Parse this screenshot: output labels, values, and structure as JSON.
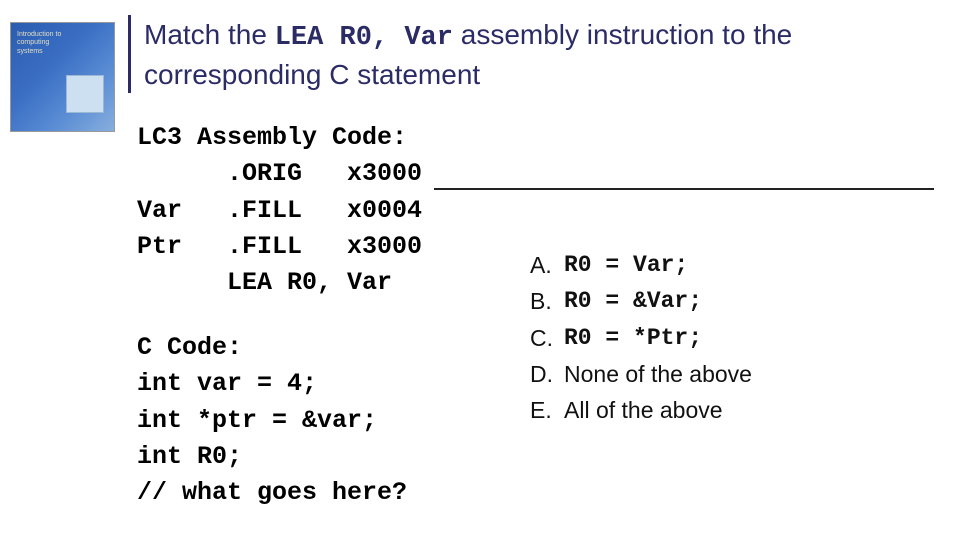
{
  "book": {
    "title_line1": "Introduction to",
    "title_line2": "computing systems"
  },
  "title": {
    "pre": "Match the ",
    "code": "LEA R0, Var",
    "post": " assembly instruction to the corresponding C statement"
  },
  "asm": {
    "header": "LC3 Assembly Code:",
    "l1": "      .ORIG   x3000",
    "l2": "Var   .FILL   x0004",
    "l3": "Ptr   .FILL   x3000",
    "l4": "      LEA R0, Var"
  },
  "ccode": {
    "header": "C Code:",
    "l1": "int var = 4;",
    "l2": "int *ptr = &var;",
    "l3": "int R0;",
    "l4": "// what goes here?"
  },
  "answers": {
    "a": {
      "label": "A.",
      "text": "R0 = Var;"
    },
    "b": {
      "label": "B.",
      "text": "R0 = &Var;"
    },
    "c": {
      "label": "C.",
      "text": "R0 = *Ptr;"
    },
    "d": {
      "label": "D.",
      "text": "None of the above"
    },
    "e": {
      "label": "E.",
      "text": "All of the above"
    }
  }
}
